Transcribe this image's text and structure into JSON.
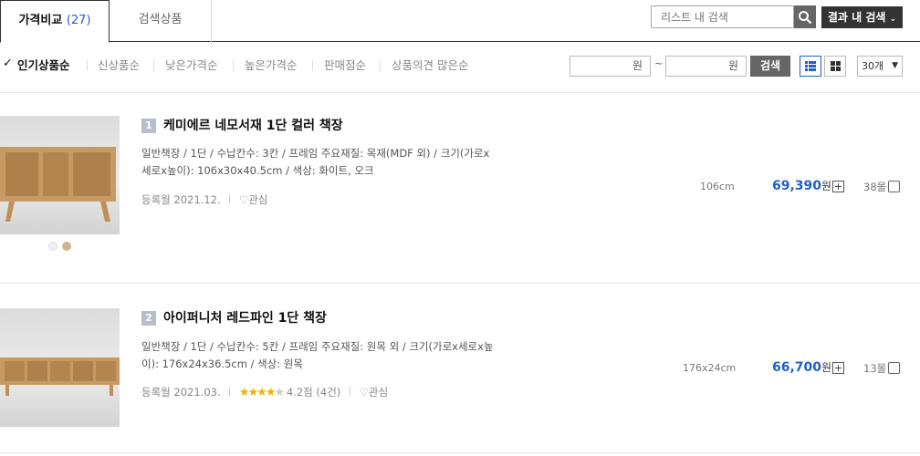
{
  "tabs": {
    "compare_label": "가격비교",
    "compare_count": "(27)",
    "search_label": "검색상품"
  },
  "search": {
    "placeholder": "리스트 내 검색",
    "result_button": "결과 내 검색"
  },
  "sorts": [
    {
      "label": "인기상품순",
      "selected": true
    },
    {
      "label": "신상품순"
    },
    {
      "label": "낮은가격순"
    },
    {
      "label": "높은가격순"
    },
    {
      "label": "판매점순"
    },
    {
      "label": "상품의견 많은순"
    }
  ],
  "price_filter": {
    "min_unit": "원",
    "tilde": "~",
    "max_unit": "원",
    "search_label": "검색"
  },
  "per_page": "30개",
  "products": [
    {
      "index": "1",
      "title": "케미에르 네모서재 1단 컬러 책장",
      "spec_line1": "일반책장 / 1단 / 수납칸수: 3칸 / 프레임 주요재질: 목재(MDF 외) / 크기(가로x",
      "spec_line2": "세로x높이): 106x30x40.5cm / 색상: 화이트, 오크",
      "reg_date": "등록월 2021.12.",
      "like_label": "관심",
      "size": "106cm",
      "price": "69,390",
      "won": "원",
      "plus": "+",
      "mall_count": "38몰"
    },
    {
      "index": "2",
      "title": "아이퍼니처 레드파인 1단 책장",
      "spec_line1": "일반책장 / 1단 / 수납칸수: 5칸 / 프레임 주요재질: 원목 외 / 크기(가로x세로x높",
      "spec_line2": "이): 176x24x36.5cm / 색상: 원목",
      "reg_date": "등록월 2021.03.",
      "rating": "4.2점",
      "reviews": "(4건)",
      "rating_value": 4.2,
      "like_label": "관심",
      "size": "176x24cm",
      "price": "66,700",
      "won": "원",
      "plus": "+",
      "mall_count": "13몰"
    }
  ]
}
